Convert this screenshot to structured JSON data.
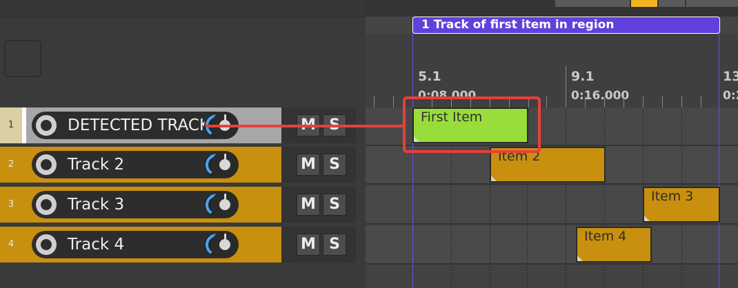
{
  "region": {
    "label": "1  Track of first item in region"
  },
  "ruler": {
    "marks": [
      {
        "bar": "5.1",
        "time": "0:08.000"
      },
      {
        "bar": "9.1",
        "time": "0:16.000"
      },
      {
        "bar": "13",
        "time": "0:2"
      }
    ]
  },
  "tracks": [
    {
      "number": "1",
      "name": "DETECTED TRACK",
      "mute": "M",
      "solo": "S",
      "selected": true
    },
    {
      "number": "2",
      "name": "Track 2",
      "mute": "M",
      "solo": "S",
      "selected": false
    },
    {
      "number": "3",
      "name": "Track 3",
      "mute": "M",
      "solo": "S",
      "selected": false
    },
    {
      "number": "4",
      "name": "Track 4",
      "mute": "M",
      "solo": "S",
      "selected": false
    }
  ],
  "items": [
    {
      "label": "First Item",
      "track": 1
    },
    {
      "label": "Item 2",
      "track": 2
    },
    {
      "label": "Item 3",
      "track": 3
    },
    {
      "label": "Item 4",
      "track": 4
    }
  ],
  "colors": {
    "track_yellow": "#c8900e",
    "track_selected": "#a7a7a7",
    "first_item_green": "#98dd3a",
    "region_purple": "#6240db",
    "highlight_red": "#e8403a",
    "knob_blue": "#4aa3f0"
  }
}
